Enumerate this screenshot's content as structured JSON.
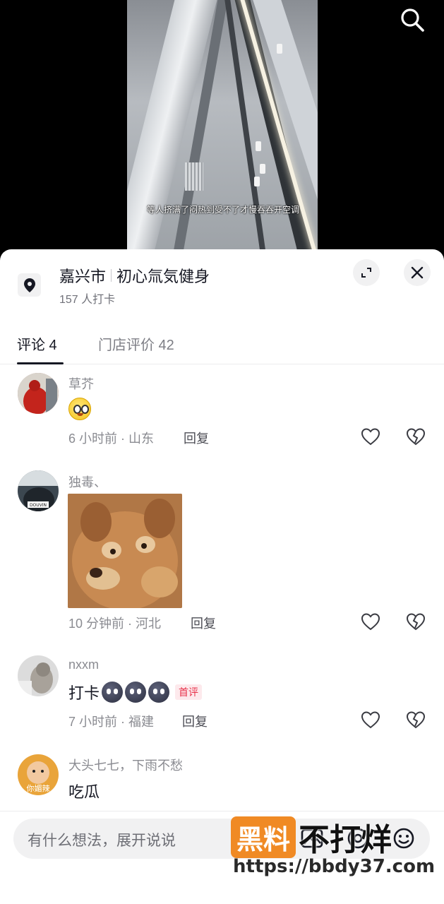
{
  "video": {
    "subtitle": "等人挤满了闷热到受不了才慢吞吞开空调"
  },
  "location": {
    "city": "嘉兴市",
    "name": "初心氚気健身",
    "checkins": "157 人打卡"
  },
  "tabs": [
    {
      "label": "评论 4",
      "active": true
    },
    {
      "label": "门店评价 42",
      "active": false
    }
  ],
  "comments": [
    {
      "user": "草芥",
      "text": "",
      "emoji": "smiley",
      "time_loc": "6 小时前 · 山东",
      "reply": "回复"
    },
    {
      "user": "独毒、",
      "text": "",
      "sticker": true,
      "time_loc": "10 分钟前 · 河北",
      "reply": "回复",
      "avatar_tag": "DOUVIN"
    },
    {
      "user": "nxxm",
      "text": "打卡",
      "badge": "首评",
      "time_loc": "7 小时前 · 福建",
      "reply": "回复"
    },
    {
      "user": "大头七七，下雨不愁",
      "text": "吃瓜",
      "avatar_tag": "你媚辣"
    }
  ],
  "input": {
    "placeholder": "有什么想法，展开说说"
  },
  "watermark": {
    "box": "黑料",
    "text": "不打烊",
    "url": "https://bbdy37.com"
  },
  "colors": {
    "text": "#161823",
    "meta": "#8a8b91",
    "badge": "#e8344c",
    "watermark": "#f08a24"
  }
}
